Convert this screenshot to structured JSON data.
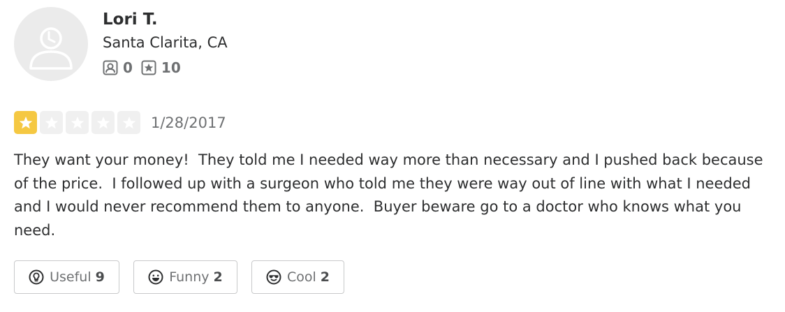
{
  "user": {
    "name": "Lori T.",
    "location": "Santa Clarita, CA",
    "friends_count": "0",
    "reviews_count": "10"
  },
  "review": {
    "rating": 1,
    "max_rating": 5,
    "date": "1/28/2017",
    "text": "They want your money!  They told me I needed way more than necessary and I pushed back because of the price.  I followed up with a surgeon who told me they were way out of line with what I needed and I would never recommend them to anyone.  Buyer beware go to a doctor who knows what you need."
  },
  "reactions": {
    "useful_label": "Useful",
    "useful_count": "9",
    "funny_label": "Funny",
    "funny_count": "2",
    "cool_label": "Cool",
    "cool_count": "2"
  },
  "icons": {
    "avatar": "default-user-avatar-icon",
    "friends": "friends-icon",
    "reviews": "star-reviews-icon",
    "useful": "lightbulb-icon",
    "funny": "smile-face-icon",
    "cool": "sunglasses-face-icon"
  },
  "colors": {
    "star_filled": "#f5c842",
    "star_empty": "#f0f0f0",
    "text_primary": "#2d2e2f",
    "text_secondary": "#6e7072"
  }
}
